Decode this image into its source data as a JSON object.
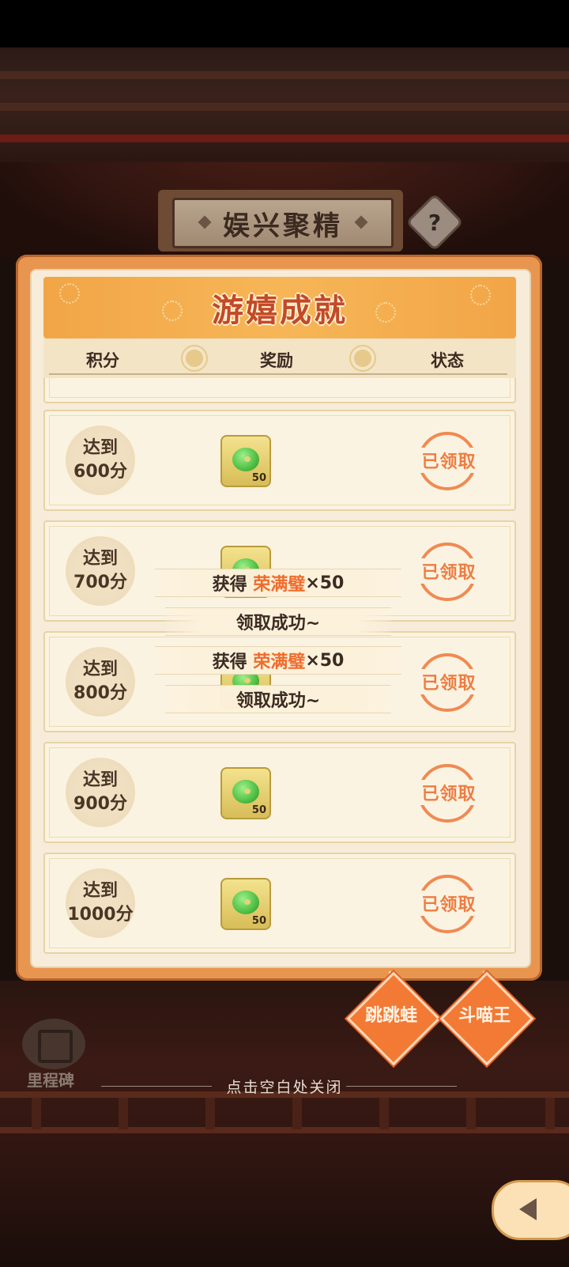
{
  "header": {
    "title": "娱兴聚精",
    "help_icon": "?"
  },
  "panel": {
    "title": "游嬉成就",
    "columns": [
      "积分",
      "奖励",
      "状态"
    ]
  },
  "rows": [
    {
      "score_prefix": "达到",
      "score": "600分",
      "reward_count": "50",
      "status": "已领取"
    },
    {
      "score_prefix": "达到",
      "score": "700分",
      "reward_count": "50",
      "status": "已领取"
    },
    {
      "score_prefix": "达到",
      "score": "800分",
      "reward_count": "50",
      "status": "已领取"
    },
    {
      "score_prefix": "达到",
      "score": "900分",
      "reward_count": "50",
      "status": "已领取"
    },
    {
      "score_prefix": "达到",
      "score": "1000分",
      "reward_count": "50",
      "status": "已领取"
    }
  ],
  "toasts": [
    {
      "prefix": "获得",
      "item": "荣满璧",
      "qty": "×50",
      "success": "领取成功~"
    },
    {
      "prefix": "获得",
      "item": "荣满璧",
      "qty": "×50",
      "success": "领取成功~"
    }
  ],
  "side_tags": [
    "跳跳蛙",
    "斗喵王"
  ],
  "milestone_label": "里程碑",
  "close_hint": "点击空白处关闭",
  "colors": {
    "accent": "#f37a34",
    "highlight": "#f06b2b",
    "panel": "#f6ecd9"
  }
}
